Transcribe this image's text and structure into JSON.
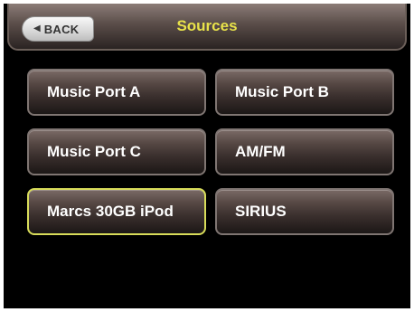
{
  "header": {
    "back_label": "BACK",
    "title": "Sources"
  },
  "sources": [
    {
      "label": "Music Port A"
    },
    {
      "label": "Music Port B"
    },
    {
      "label": "Music Port C"
    },
    {
      "label": "AM/FM"
    },
    {
      "label": "Marcs 30GB iPod",
      "selected": true
    },
    {
      "label": "SIRIUS"
    }
  ],
  "colors": {
    "title": "#e8e24a",
    "selected_border": "#d8dc5a",
    "background": "#000000"
  }
}
